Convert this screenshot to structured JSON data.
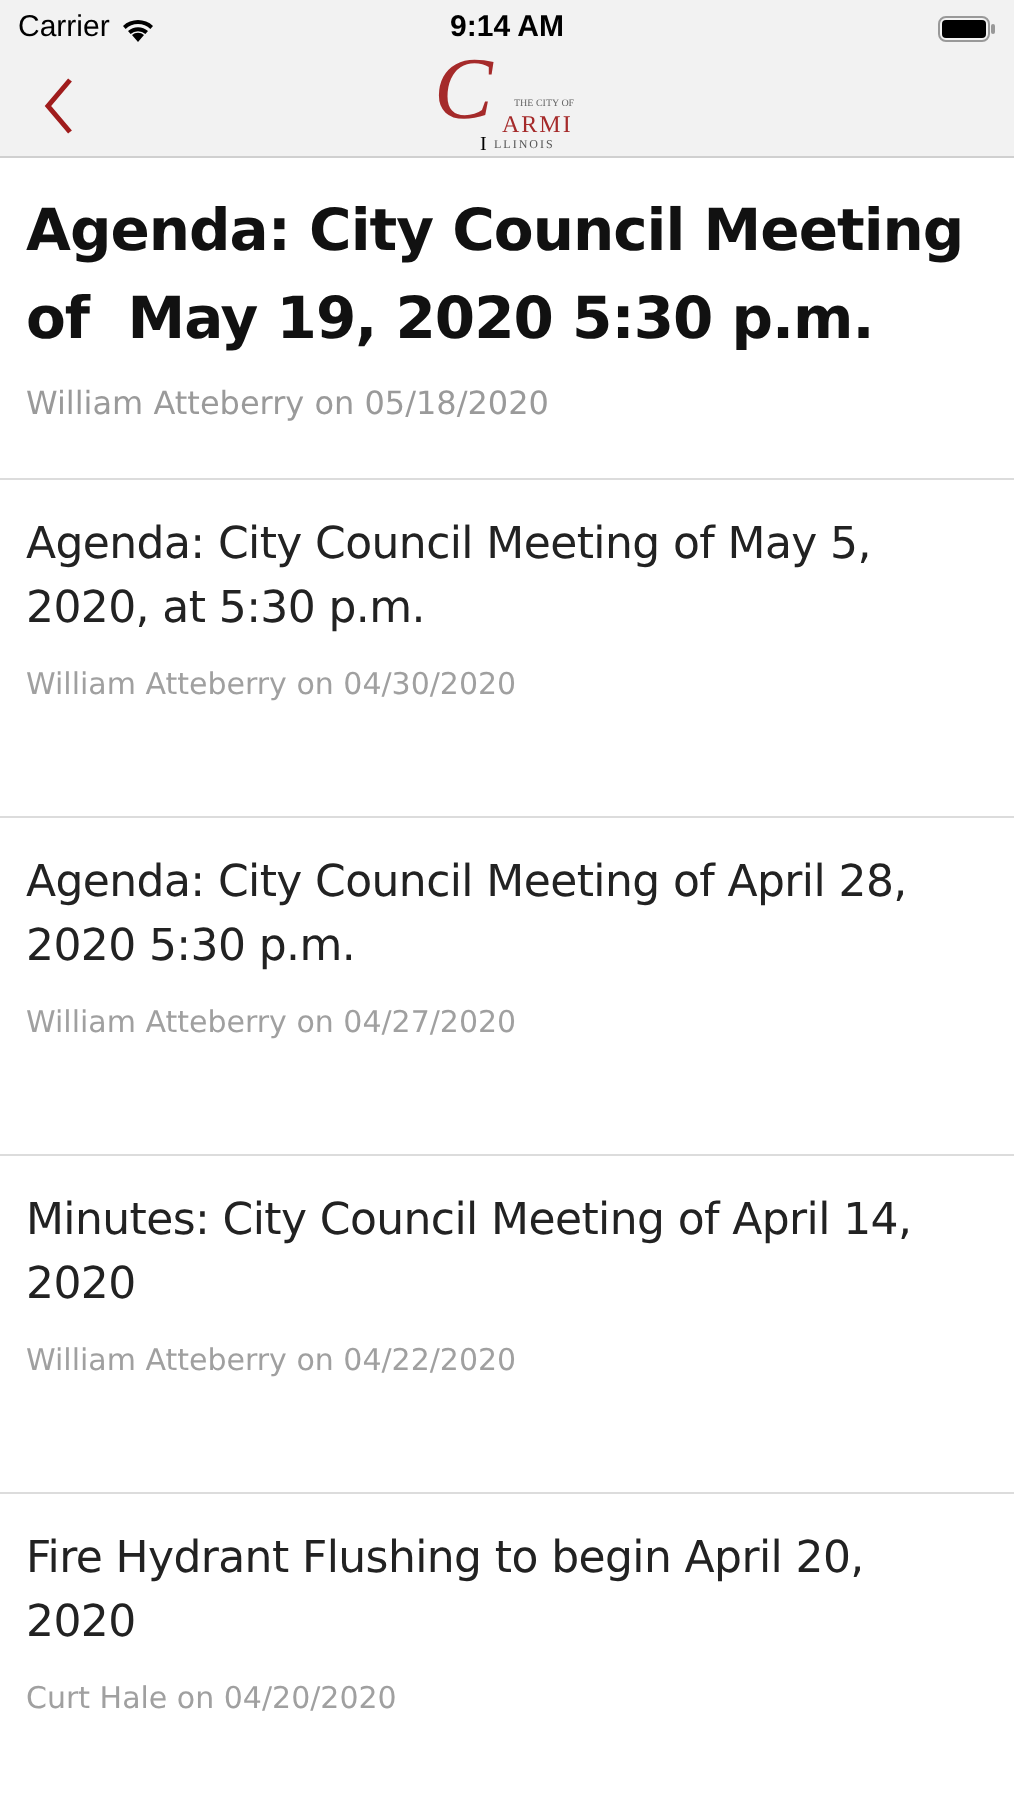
{
  "status_bar": {
    "carrier": "Carrier",
    "time": "9:14 AM"
  },
  "logo": {
    "script_letter": "C",
    "tagline": "THE CITY OF",
    "name_rest": "ARMI",
    "state_initial": "I",
    "state_rest": "LLINOIS"
  },
  "posts": [
    {
      "kind": "featured",
      "title": "Agenda: City Council Meeting of  May 19, 2020 5:30 p.m.",
      "byline": "William Atteberry on 05/18/2020"
    },
    {
      "kind": "regular",
      "title": "Agenda: City Council Meeting of May 5, 2020, at 5:30 p.m.",
      "byline": "William Atteberry on 04/30/2020"
    },
    {
      "kind": "regular",
      "title": "Agenda: City Council Meeting of April 28, 2020 5:30 p.m.",
      "byline": "William Atteberry on 04/27/2020"
    },
    {
      "kind": "regular",
      "title": "Minutes: City Council Meeting of April 14, 2020",
      "byline": "William Atteberry on 04/22/2020"
    },
    {
      "kind": "regular",
      "title": "Fire Hydrant Flushing to begin April 20, 2020",
      "byline": "Curt Hale on 04/20/2020"
    }
  ]
}
